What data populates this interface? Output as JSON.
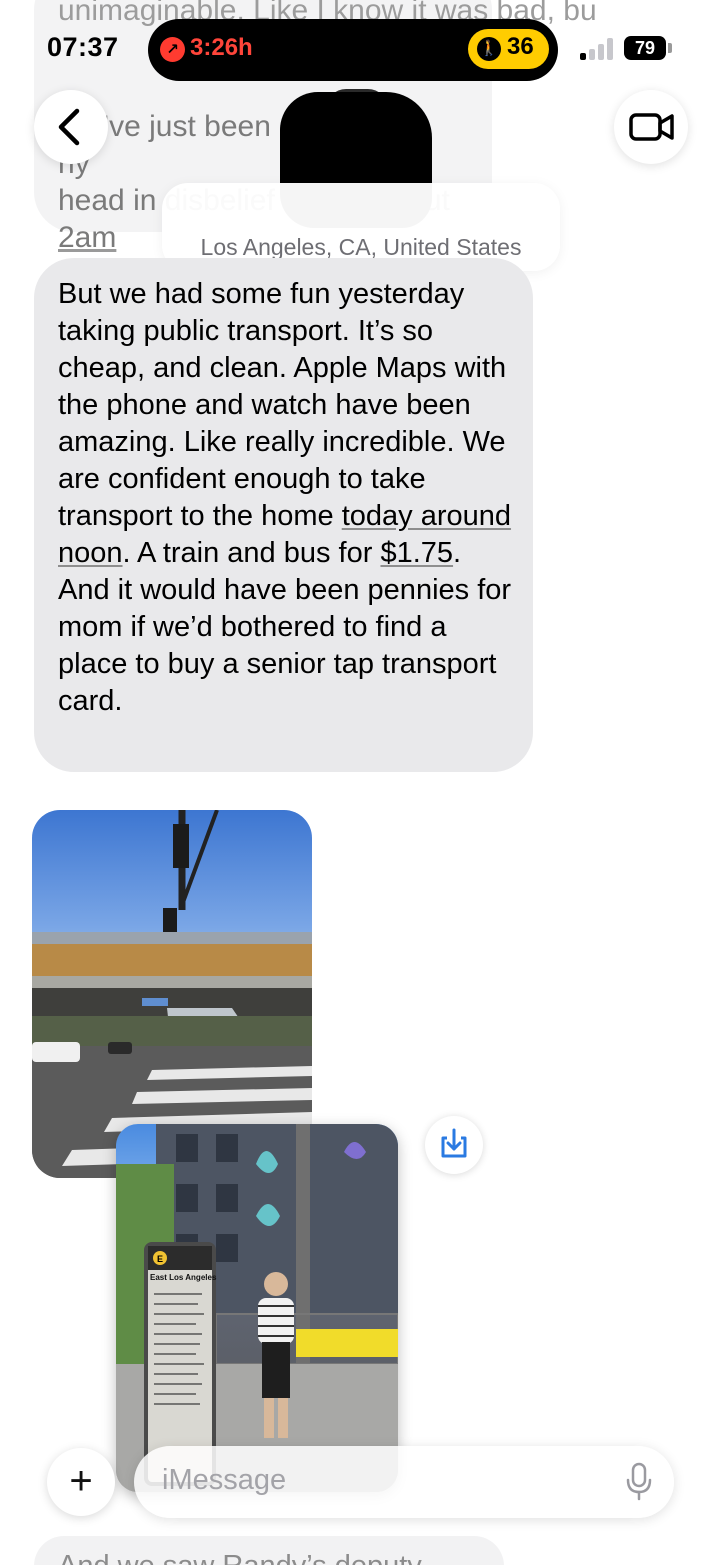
{
  "status_bar": {
    "time": "07:37",
    "recording_time": "3:26h",
    "activity_count": "36",
    "battery": "79",
    "signal_bars_active": 1,
    "signal_bars_total": 4
  },
  "header": {
    "location": "Los Angeles, CA, United States",
    "contact_name_redacted": true
  },
  "previous_message": {
    "partial_line": "unimaginable. Like I know it was bad, bu",
    "text_before": "We’ve just been s",
    "text_middle_a": "ny",
    "text_line2a": "head in disbelief",
    "text_line2b": "ut",
    "link": "2am"
  },
  "message": {
    "part1": "But we had some fun yesterday taking public transport. It’s so cheap, and clean. Apple Maps with the phone and watch have been amazing. Like really incredible. We are confident enough to take transport to the home ",
    "link1": "today around noon",
    "part2": ". A train and bus for ",
    "link2": "$1.75",
    "part3": ". And it would have been pennies for mom if we’d bothered to find a place to buy a senior tap transport card."
  },
  "photos": {
    "photo1_sign": "",
    "photo2_sign_letter": "E",
    "photo2_sign_title": "East Los Angeles"
  },
  "compose": {
    "placeholder": "iMessage",
    "plus_label": "+"
  },
  "next_message_partial": "And we saw Randy’s deputy",
  "colors": {
    "bubble_gray": "#e9e9eb",
    "record_red": "#ff453a",
    "activity_yellow": "#ffcc00",
    "link_blue": "#0a84ff"
  },
  "icons": {
    "back": "chevron-left-icon",
    "video": "video-camera-icon",
    "save": "save-download-icon",
    "mic": "microphone-icon",
    "record": "arrow-up-right-icon",
    "activity": "walking-figure-icon"
  }
}
